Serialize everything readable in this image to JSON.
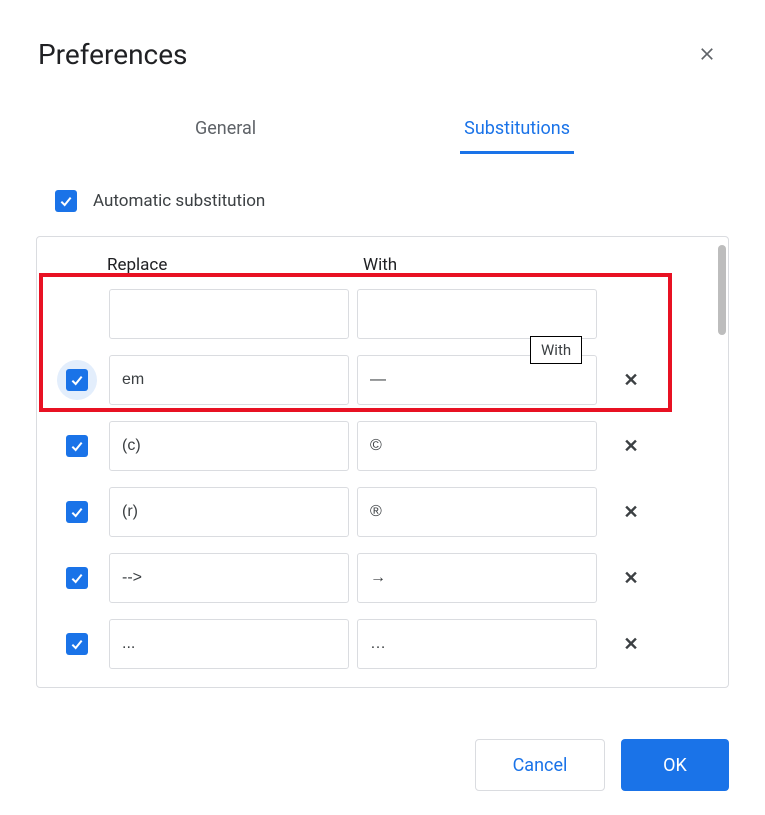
{
  "dialog": {
    "title": "Preferences"
  },
  "tabs": {
    "general": "General",
    "substitutions": "Substitutions",
    "active": "substitutions"
  },
  "auto_substitution": {
    "label": "Automatic substitution",
    "checked": true
  },
  "columns": {
    "replace": "Replace",
    "with": "With"
  },
  "tooltip": "With",
  "rows": [
    {
      "checked": null,
      "replace": "",
      "with": "",
      "deletable": false,
      "focused": false
    },
    {
      "checked": true,
      "replace": "em",
      "with": "—",
      "deletable": true,
      "focused": true
    },
    {
      "checked": true,
      "replace": "(c)",
      "with": "©",
      "deletable": true,
      "focused": false
    },
    {
      "checked": true,
      "replace": "(r)",
      "with": "®",
      "deletable": true,
      "focused": false
    },
    {
      "checked": true,
      "replace": "-->",
      "with": "→",
      "deletable": true,
      "focused": false
    },
    {
      "checked": true,
      "replace": "...",
      "with": "…",
      "deletable": true,
      "focused": false
    }
  ],
  "buttons": {
    "cancel": "Cancel",
    "ok": "OK"
  },
  "colors": {
    "accent": "#1a73e8",
    "highlight": "#e81123"
  }
}
